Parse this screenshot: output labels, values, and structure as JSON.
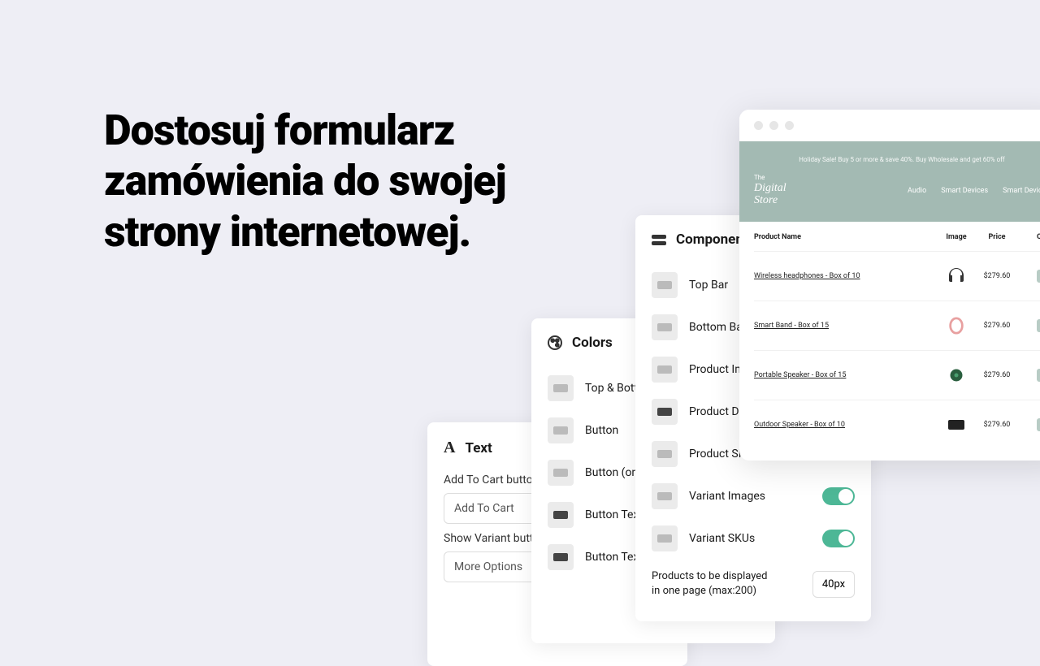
{
  "headline": "Dostosuj formularz zamówienia do swojej strony internetowej.",
  "text_panel": {
    "title": "Text",
    "add_to_cart_label": "Add To Cart button",
    "add_to_cart_value": "Add To Cart",
    "show_variant_label": "Show Variant button",
    "show_variant_value": "More Options"
  },
  "colors_panel": {
    "title": "Colors",
    "items": [
      {
        "label": "Top & Bottom",
        "dark": false
      },
      {
        "label": "Button",
        "dark": false
      },
      {
        "label": "Button (on hover)",
        "dark": false
      },
      {
        "label": "Button Text",
        "dark": true
      },
      {
        "label": "Button Text (on hover)",
        "dark": true
      }
    ]
  },
  "components_panel": {
    "title": "Components",
    "items": [
      {
        "label": "Top Bar",
        "dark": false
      },
      {
        "label": "Bottom Bar",
        "dark": false
      },
      {
        "label": "Product Images",
        "dark": false
      },
      {
        "label": "Product Description",
        "dark": true
      },
      {
        "label": "Product SKUs",
        "dark": false
      }
    ],
    "toggles": [
      {
        "label": "Variant Images",
        "on": true
      },
      {
        "label": "Variant SKUs",
        "on": true
      }
    ],
    "ppp_label": "Products to be displayed in one page (max:200)",
    "ppp_value": "40px"
  },
  "store": {
    "banner": "Holiday Sale! Buy 5 or more & save 40%. Buy Wholesale and get 60% off",
    "logo_the": "The",
    "logo_name": "Digital",
    "logo_sub": "Store",
    "nav": [
      "Audio",
      "Smart Devices",
      "Smart Devices"
    ],
    "cols": {
      "name": "Product Name",
      "image": "Image",
      "price": "Price",
      "qty": "Qua"
    },
    "products": [
      {
        "name": "Wireless headphones - Box of 10",
        "price": "$279.60",
        "icon": "headphones",
        "bg": "#fff"
      },
      {
        "name": "Smart Band - Box of 15",
        "price": "$279.60",
        "icon": "band",
        "bg": "#fff"
      },
      {
        "name": "Portable Speaker - Box of 15",
        "price": "$279.60",
        "icon": "speaker",
        "bg": "#fff"
      },
      {
        "name": "Outdoor Speaker - Box of 10",
        "price": "$279.60",
        "icon": "speaker2",
        "bg": "#fff"
      }
    ]
  }
}
